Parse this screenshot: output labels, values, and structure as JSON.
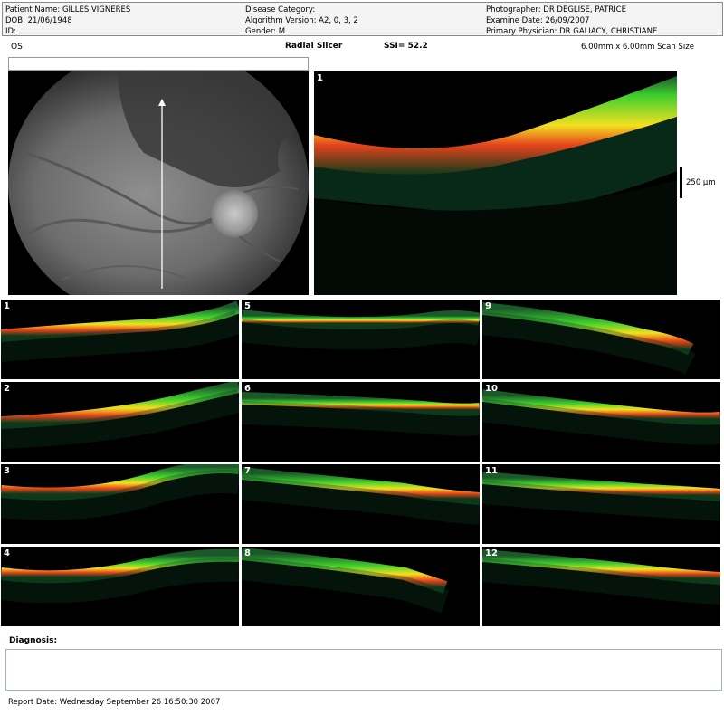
{
  "header": {
    "patient_name": "Patient Name: GILLES  VIGNERES",
    "dob": "DOB: 21/06/1948",
    "id": "ID:",
    "disease_category": "Disease Category:",
    "algorithm_version": "Algorithm Version: A2, 0, 3, 2",
    "gender": "Gender: M",
    "photographer": "Photographer: DR DEGLISE, PATRICE",
    "exam_date": "Examine Date: 26/09/2007",
    "primary_physician": "Primary Physician: DR GALIACY, CHRISTIANE"
  },
  "scan": {
    "eye": "OS",
    "mode": "Radial Slicer",
    "ssi": "SSI= 52.2",
    "scan_size": "6.00mm x 6.00mm Scan Size",
    "scale_label": "250 µm",
    "main_scan_number": "1"
  },
  "thumbnails": [
    "1",
    "2",
    "3",
    "4",
    "5",
    "6",
    "7",
    "8",
    "9",
    "10",
    "11",
    "12"
  ],
  "diagnosis": {
    "label": "Diagnosis:",
    "value": ""
  },
  "footer": {
    "report_date": "Report Date: Wednesday September 26 16:50:30 2007"
  },
  "colors": {
    "retina_green": "#3fcf2e",
    "retina_yellow": "#f2e020",
    "retina_red": "#e6441c",
    "background": "#000000"
  }
}
